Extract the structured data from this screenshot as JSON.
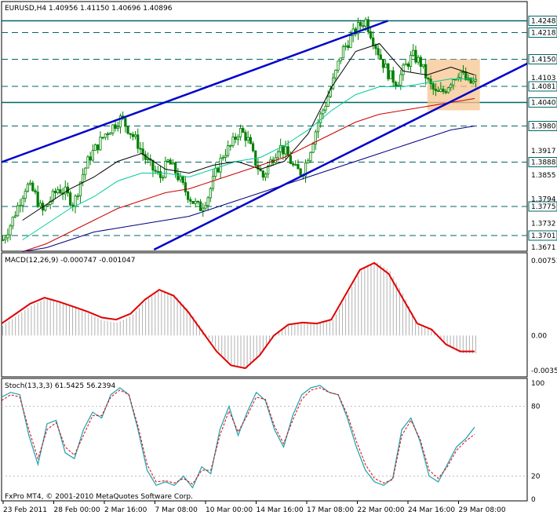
{
  "window": {
    "symbol_header": "EURUSD,H4  1.40956 1.41150 1.40696 1.40896",
    "macd_header": "MACD(12,26,9) -0.000747 -0.001047",
    "stoch_header": "Stoch(13,3,3) 61.5425 56.2394",
    "copyright": "FxPro MT4, © 2001-2010 MetaQuotes Software Corp."
  },
  "colors": {
    "candle": "#008000",
    "channel": "#0000cc",
    "ma_fast": "#000000",
    "ma_mid": "#00cc99",
    "ma_slow": "#cc0000",
    "ma_long": "#000080",
    "hline": "#006666",
    "macd_line": "#e00000",
    "macd_hist": "#b0b0b0",
    "stoch_main": "#2aa6b5",
    "stoch_signal": "#e00000",
    "highlight": "#f5c48f",
    "price_tag_bg": "#ffffff"
  },
  "chart_data": [
    {
      "type": "candlestick",
      "title": "EURUSD,H4",
      "ylim": [
        1.3665,
        1.4265
      ],
      "price_ticks": [
        "1.4248",
        "1.4218",
        "1.4150",
        "1.4103",
        "1.4081",
        "1.4040",
        "1.3980",
        "1.3917",
        "1.3888",
        "1.3855",
        "1.3794",
        "1.3775",
        "1.3732",
        "1.3701",
        "1.3671"
      ],
      "horizontal_levels": [
        1.4248,
        1.4218,
        1.415,
        1.4081,
        1.404,
        1.398,
        1.3888,
        1.3775,
        1.3701
      ],
      "solid_levels": [
        1.4248,
        1.404
      ],
      "x_labels": [
        "23 Feb 2011",
        "28 Feb 00:00",
        "2 Mar 16:00",
        "7 Mar 08:00",
        "10 Mar 00:00",
        "14 Mar 16:00",
        "17 Mar 08:00",
        "22 Mar 00:00",
        "24 Mar 16:00",
        "29 Mar 08:00"
      ],
      "close_path": [
        1.369,
        1.373,
        1.378,
        1.383,
        1.381,
        1.376,
        1.379,
        1.382,
        1.381,
        1.378,
        1.385,
        1.39,
        1.393,
        1.396,
        1.398,
        1.4,
        1.397,
        1.394,
        1.39,
        1.387,
        1.385,
        1.389,
        1.386,
        1.382,
        1.379,
        1.377,
        1.38,
        1.386,
        1.391,
        1.393,
        1.397,
        1.395,
        1.389,
        1.385,
        1.389,
        1.393,
        1.391,
        1.387,
        1.386,
        1.392,
        1.399,
        1.404,
        1.41,
        1.417,
        1.42,
        1.423,
        1.425,
        1.42,
        1.415,
        1.411,
        1.409,
        1.413,
        1.416,
        1.414,
        1.409,
        1.406,
        1.407,
        1.41,
        1.412,
        1.409,
        1.409
      ],
      "moving_averages": [
        {
          "key": "ma_fast",
          "values": [
            1.374,
            1.378,
            1.382,
            1.385,
            1.389,
            1.391,
            1.387,
            1.386,
            1.388,
            1.389,
            1.387,
            1.389,
            1.396,
            1.408,
            1.417,
            1.419,
            1.412,
            1.411,
            1.413,
            1.411
          ]
        },
        {
          "key": "ma_mid",
          "values": [
            1.369,
            1.373,
            1.377,
            1.38,
            1.384,
            1.386,
            1.386,
            1.385,
            1.387,
            1.389,
            1.39,
            1.393,
            1.397,
            1.402,
            1.406,
            1.408,
            1.408,
            1.409,
            1.41,
            1.41
          ]
        },
        {
          "key": "ma_slow",
          "values": [
            1.366,
            1.368,
            1.371,
            1.374,
            1.377,
            1.379,
            1.381,
            1.382,
            1.384,
            1.386,
            1.388,
            1.39,
            1.393,
            1.396,
            1.399,
            1.401,
            1.402,
            1.403,
            1.404,
            1.405
          ]
        },
        {
          "key": "ma_long",
          "values": [
            1.366,
            1.367,
            1.369,
            1.371,
            1.372,
            1.373,
            1.374,
            1.375,
            1.377,
            1.379,
            1.381,
            1.383,
            1.385,
            1.387,
            1.389,
            1.391,
            1.393,
            1.395,
            1.397,
            1.398
          ]
        }
      ],
      "channel_lines": [
        {
          "from": [
            0,
            1.3888
          ],
          "to": [
            0.735,
            1.4248
          ]
        },
        {
          "from": [
            0.29,
            1.3665
          ],
          "to": [
            1.0,
            1.4139
          ]
        }
      ],
      "highlight_zone": {
        "x_from": 0.81,
        "x_to": 0.91,
        "y_from": 1.402,
        "y_to": 1.415
      }
    },
    {
      "type": "histogram",
      "title": "MACD(12,26,9)",
      "ylim": [
        -0.004,
        0.008
      ],
      "ticks": [
        "0.00751",
        "0.00",
        "-0.00354"
      ],
      "histogram": [
        0.001,
        0.002,
        0.003,
        0.0037,
        0.0033,
        0.0028,
        0.0022,
        0.0015,
        0.0013,
        0.002,
        0.0035,
        0.0046,
        0.0041,
        0.0025,
        0.0005,
        -0.0015,
        -0.003,
        -0.0034,
        -0.002,
        0.0,
        0.0012,
        0.0014,
        0.0012,
        0.0015,
        0.004,
        0.0065,
        0.0075,
        0.0065,
        0.004,
        0.001,
        0.0005,
        -0.001,
        -0.0018,
        -0.0018
      ],
      "signal": [
        0.0012,
        0.0022,
        0.0032,
        0.0038,
        0.0034,
        0.0029,
        0.0024,
        0.0018,
        0.0016,
        0.0022,
        0.0036,
        0.0046,
        0.004,
        0.0024,
        0.0004,
        -0.0016,
        -0.003,
        -0.0033,
        -0.002,
        0.0,
        0.0011,
        0.0013,
        0.0012,
        0.0016,
        0.0041,
        0.0066,
        0.0073,
        0.0062,
        0.0037,
        0.0012,
        0.0006,
        -0.0009,
        -0.0016,
        -0.0016
      ]
    },
    {
      "type": "line",
      "title": "Stoch(13,3,3)",
      "ylim": [
        0,
        100
      ],
      "ticks": [
        "100",
        "80",
        "20",
        "0"
      ],
      "main": [
        88,
        92,
        90,
        55,
        30,
        65,
        68,
        40,
        35,
        60,
        75,
        70,
        90,
        96,
        90,
        60,
        25,
        12,
        15,
        12,
        20,
        10,
        28,
        22,
        60,
        80,
        55,
        75,
        92,
        85,
        60,
        45,
        72,
        90,
        96,
        98,
        92,
        90,
        70,
        45,
        25,
        15,
        12,
        18,
        60,
        70,
        50,
        20,
        15,
        30,
        45,
        52,
        62
      ],
      "signal": [
        85,
        90,
        88,
        60,
        35,
        60,
        66,
        45,
        38,
        55,
        72,
        72,
        88,
        94,
        90,
        63,
        30,
        15,
        16,
        14,
        18,
        13,
        25,
        25,
        55,
        76,
        58,
        72,
        88,
        86,
        63,
        48,
        68,
        86,
        94,
        96,
        92,
        90,
        73,
        50,
        30,
        18,
        14,
        17,
        55,
        68,
        52,
        25,
        18,
        28,
        42,
        50,
        56
      ]
    }
  ]
}
